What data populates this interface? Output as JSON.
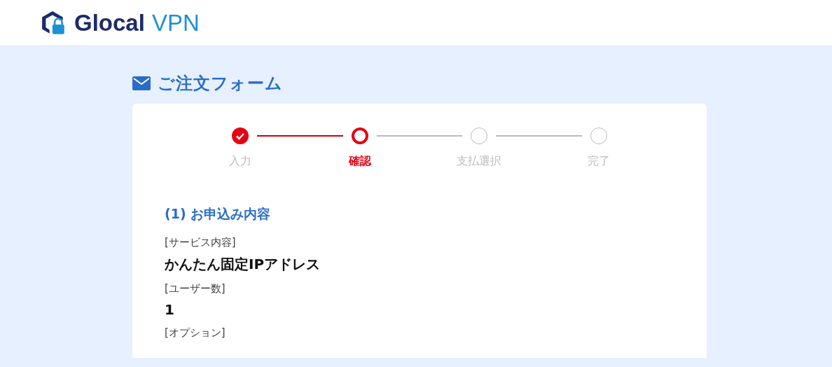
{
  "header": {
    "logo": {
      "brand": "Glocal",
      "product": "VPN"
    }
  },
  "page_title": "ご注文フォーム",
  "steps": [
    {
      "label": "入力",
      "kind": "done"
    },
    {
      "label": "確認",
      "kind": "current"
    },
    {
      "label": "支払選択",
      "kind": "todo"
    },
    {
      "label": "完了",
      "kind": "todo"
    }
  ],
  "section": {
    "heading": "(1) お申込み内容",
    "fields": [
      {
        "label": "[サービス内容]",
        "value": "かんたん固定IPアドレス"
      },
      {
        "label": "[ユーザー数]",
        "value": "1"
      },
      {
        "label": "[オプション]"
      }
    ]
  }
}
